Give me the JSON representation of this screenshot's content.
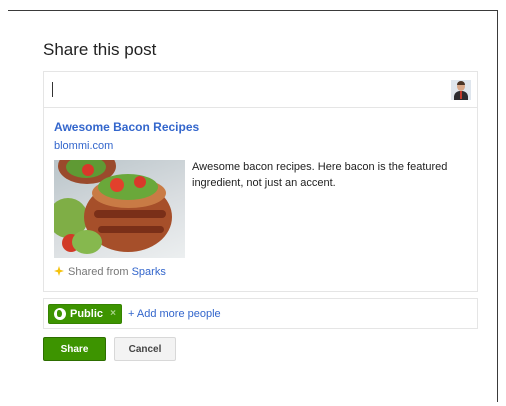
{
  "dialog": {
    "title": "Share this post"
  },
  "compose": {
    "value": "",
    "placeholder": ""
  },
  "attachment": {
    "title": "Awesome Bacon Recipes",
    "domain": "blommi.com",
    "description": "Awesome bacon recipes. Here bacon is the featured ingredient, not just an accent.",
    "shared_from_prefix": "Shared from",
    "shared_from_source": "Sparks"
  },
  "audience": {
    "chip_label": "Public",
    "chip_remove": "×",
    "add_more": "+ Add more people"
  },
  "actions": {
    "share_label": "Share",
    "cancel_label": "Cancel"
  },
  "colors": {
    "link": "#3366cc",
    "share_green": "#3d9400",
    "text": "#222222",
    "muted": "#777777"
  },
  "icons": {
    "avatar": "user-avatar-photo",
    "spark": "sparkle-icon",
    "globe": "globe-icon",
    "thumbnail": "bacon-bowl-photo"
  }
}
